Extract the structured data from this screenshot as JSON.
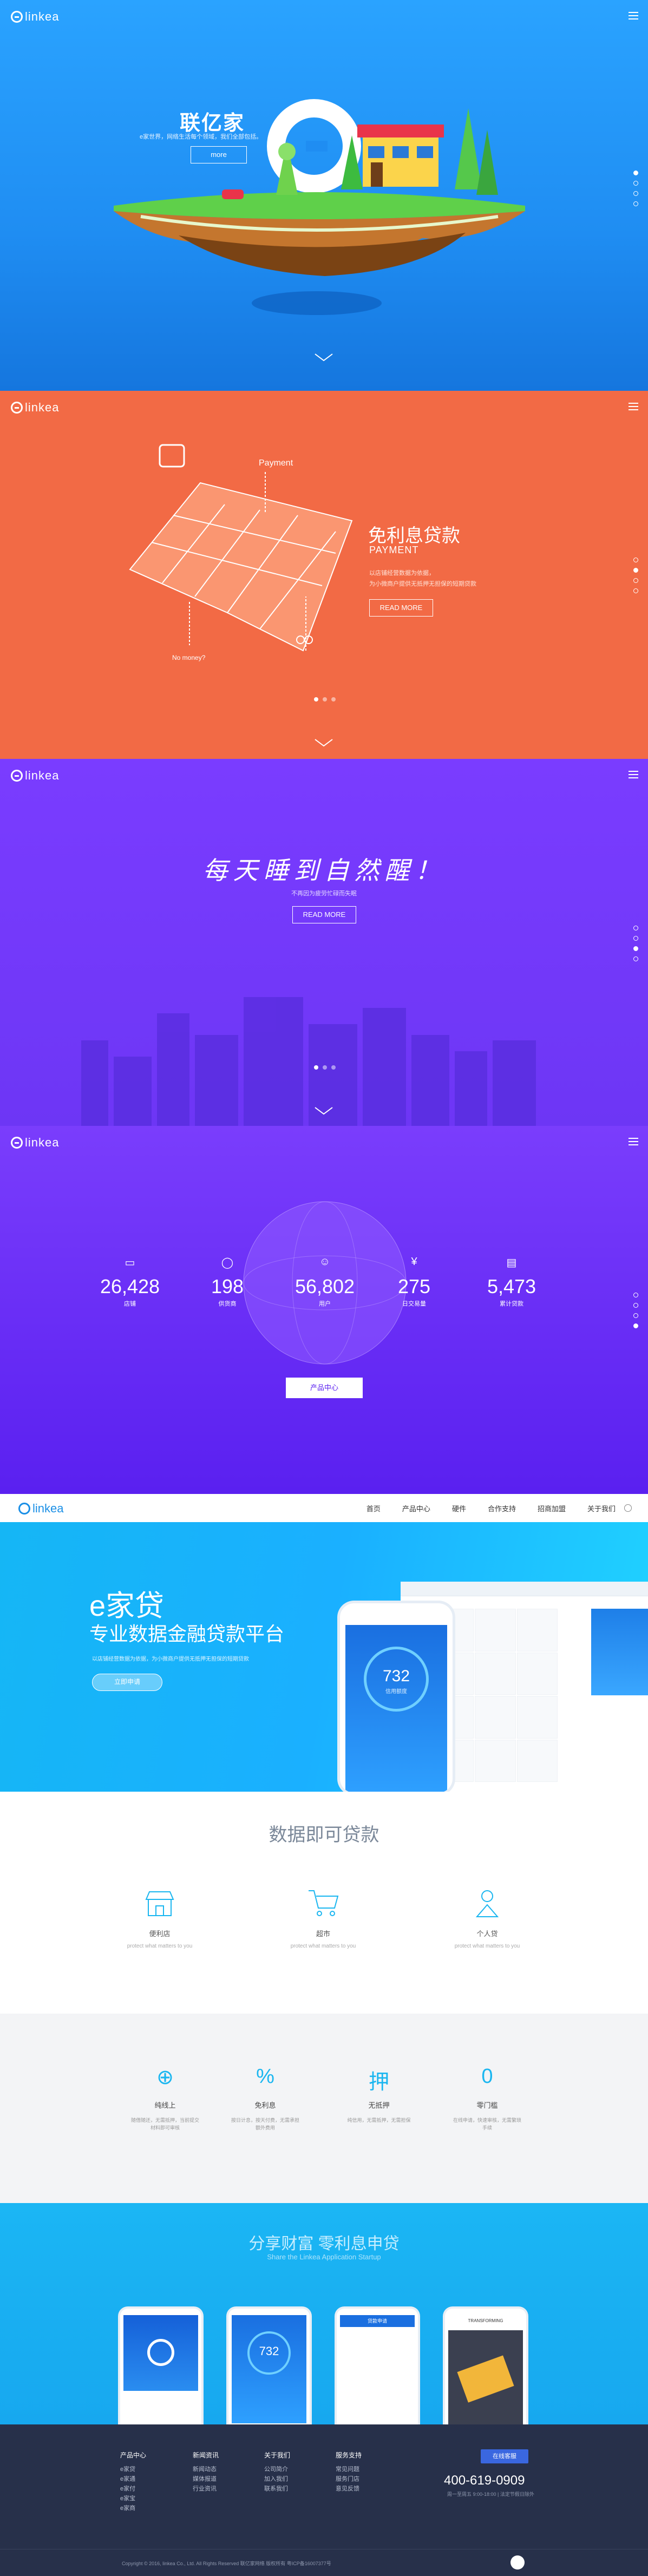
{
  "brand": {
    "logo_text": "linkea"
  },
  "slide1": {
    "title": "联亿家",
    "subtitle": "e家世界，网络生活每个领域，我们全部包括。",
    "button": "more",
    "dots": 4,
    "active_dot": 0
  },
  "slide2": {
    "payment_label": "Payment",
    "nomoney_label": "No money?",
    "title": "免利息贷款",
    "title_en": "PAYMENT",
    "desc1": "以店铺经营数据为依据，",
    "desc2": "为小微商户提供无抵押无担保的短期贷款",
    "button": "READ MORE"
  },
  "slide3": {
    "slogan": "每天睡到自然醒！",
    "sub": "不再因为疲劳忙碌而失眠",
    "button": "READ MORE"
  },
  "stats": {
    "items": [
      {
        "icon": "calendar-icon",
        "value": "26,428",
        "label": "店铺"
      },
      {
        "icon": "user-icon",
        "value": "198",
        "label": "供货商"
      },
      {
        "icon": "smile-icon",
        "value": "56,802",
        "label": "用户"
      },
      {
        "icon": "yen-icon",
        "value": "275",
        "label": "日交易量"
      },
      {
        "icon": "card-icon",
        "value": "5,473",
        "label": "累计贷款"
      }
    ],
    "button": "产品中心"
  },
  "nav": {
    "items": [
      "首页",
      "产品中心",
      "硬件",
      "合作支持",
      "招商加盟",
      "关于我们"
    ]
  },
  "hero": {
    "brand_line": "e家贷",
    "headline": "专业数据金融贷款平台",
    "desc": "以店铺经营数据为依据，为小微商户提供无抵押无担保的短期贷款",
    "button": "立即申请",
    "phone_value": "732",
    "phone_caption": "信用额度"
  },
  "loan": {
    "title": "数据即可贷款",
    "features": [
      {
        "icon": "shop-icon",
        "title": "便利店",
        "desc": "protect what matters to you"
      },
      {
        "icon": "cart-icon",
        "title": "超市",
        "desc": "protect what matters to you"
      },
      {
        "icon": "person-icon",
        "title": "个人贷",
        "desc": "protect what matters to you"
      }
    ]
  },
  "benefits": {
    "items": [
      {
        "icon": "globe-icon",
        "glyph": "⊕",
        "title": "纯线上",
        "desc": "随借随还，无需抵押，当前提交材料即可审核"
      },
      {
        "icon": "percent-icon",
        "glyph": "%",
        "title": "免利息",
        "desc": "按日计息，按天付费，无需承担额外费用"
      },
      {
        "icon": "pledge-icon",
        "glyph": "押",
        "title": "无抵押",
        "desc": "纯信用，无需抵押，无需担保"
      },
      {
        "icon": "zero-icon",
        "glyph": "0",
        "title": "零门槛",
        "desc": "在线申请，快速审核，无需繁琐手续"
      }
    ]
  },
  "share": {
    "title": "分享财富 零利息申贷",
    "subtitle": "Share the Linkea Application Startup",
    "phone2_value": "732",
    "phone3_title": "贷款申请",
    "phone4_title": "TRANSFORMING"
  },
  "footer": {
    "cols": [
      {
        "head": "产品中心",
        "items": [
          "e家贷",
          "e家通",
          "e家付",
          "e家宝",
          "e家商"
        ]
      },
      {
        "head": "新闻资讯",
        "items": [
          "新闻动态",
          "媒体报道",
          "行业资讯"
        ]
      },
      {
        "head": "关于我们",
        "items": [
          "公司简介",
          "加入我们",
          "联系我们"
        ]
      },
      {
        "head": "服务支持",
        "items": [
          "常见问题",
          "服务门店",
          "意见反馈"
        ]
      }
    ],
    "button": "在线客服",
    "phone": "400-619-0909",
    "hours": "周一至周五 9:00-18:00 | 法定节假日除外",
    "copyright": "Copyright © 2016, linkea Co., Ltd. All Rights Reserved 联亿家网络 版权所有 粤ICP备16007377号"
  },
  "colors": {
    "s1": "#2aa3ff",
    "s2": "#f26a45",
    "s3": "#7a3cff",
    "s4": "#6a2ff5",
    "hero": "#1ab0ff",
    "share": "#1bb6f4",
    "footer": "#27304a",
    "accent": "#2a7bd6"
  }
}
